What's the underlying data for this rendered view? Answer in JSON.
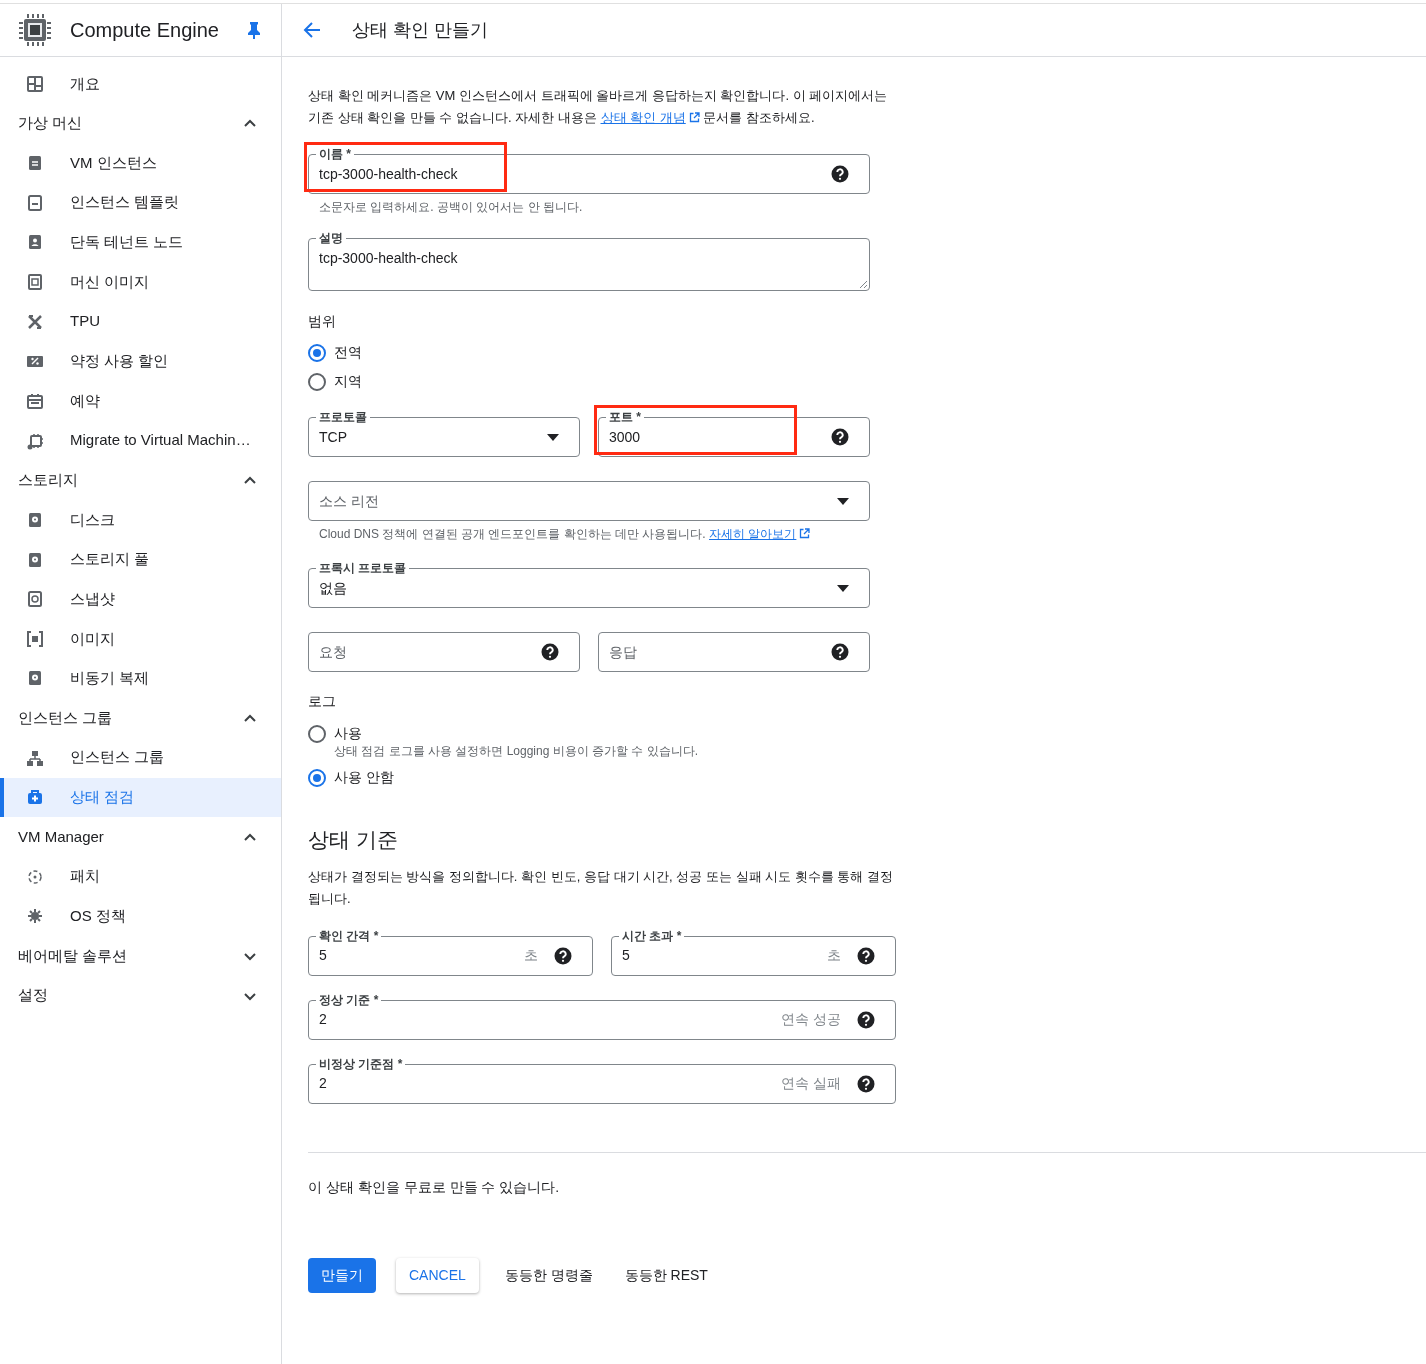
{
  "app": {
    "title": "Compute Engine"
  },
  "sidebar": {
    "items": [
      {
        "kind": "link",
        "label": "개요",
        "selected": false
      },
      {
        "kind": "section",
        "label": "가상 머신",
        "expanded": true,
        "children": [
          {
            "kind": "link",
            "label": "VM 인스턴스",
            "selected": false
          },
          {
            "kind": "link",
            "label": "인스턴스 템플릿",
            "selected": false
          },
          {
            "kind": "link",
            "label": "단독 테넌트 노드",
            "selected": false
          },
          {
            "kind": "link",
            "label": "머신 이미지",
            "selected": false
          },
          {
            "kind": "link",
            "label": "TPU",
            "selected": false
          },
          {
            "kind": "link",
            "label": "약정 사용 할인",
            "selected": false
          },
          {
            "kind": "link",
            "label": "예약",
            "selected": false
          },
          {
            "kind": "link",
            "label": "Migrate to Virtual Machin…",
            "selected": false
          }
        ]
      },
      {
        "kind": "section",
        "label": "스토리지",
        "expanded": true,
        "children": [
          {
            "kind": "link",
            "label": "디스크",
            "selected": false
          },
          {
            "kind": "link",
            "label": "스토리지 풀",
            "selected": false
          },
          {
            "kind": "link",
            "label": "스냅샷",
            "selected": false
          },
          {
            "kind": "link",
            "label": "이미지",
            "selected": false
          },
          {
            "kind": "link",
            "label": "비동기 복제",
            "selected": false
          }
        ]
      },
      {
        "kind": "section",
        "label": "인스턴스 그룹",
        "expanded": true,
        "children": [
          {
            "kind": "link",
            "label": "인스턴스 그룹",
            "selected": false
          },
          {
            "kind": "link",
            "label": "상태 점검",
            "selected": true
          }
        ]
      },
      {
        "kind": "section",
        "label": "VM Manager",
        "expanded": true,
        "children": [
          {
            "kind": "link",
            "label": "패치",
            "selected": false
          },
          {
            "kind": "link",
            "label": "OS 정책",
            "selected": false
          }
        ]
      },
      {
        "kind": "section",
        "label": "베어메탈 솔루션",
        "expanded": false
      },
      {
        "kind": "section",
        "label": "설정",
        "expanded": false
      }
    ]
  },
  "page": {
    "title": "상태 확인 만들기"
  },
  "intro": {
    "before": "상태 확인 메커니즘은 VM 인스턴스에서 트래픽에 올바르게 응답하는지 확인합니다. 이 페이지에서는 기존 상태 확인을 만들 수 없습니다. 자세한 내용은 ",
    "link": "상태 확인 개념",
    "after": " 문서를 참조하세요."
  },
  "name_field": {
    "label": "이름 *",
    "value": "tcp-3000-health-check",
    "help": "소문자로 입력하세요. 공백이 있어서는 안 됩니다.",
    "highlighted": true
  },
  "description_field": {
    "label": "설명",
    "value": "tcp-3000-health-check"
  },
  "scope": {
    "label": "범위",
    "options": [
      {
        "label": "전역",
        "selected": true
      },
      {
        "label": "지역",
        "selected": false
      }
    ]
  },
  "protocol_field": {
    "label": "프로토콜",
    "value": "TCP"
  },
  "port_field": {
    "label": "포트 *",
    "value": "3000",
    "highlighted": true
  },
  "source_region_field": {
    "placeholder": "소스 리전",
    "help": "Cloud DNS 정책에 연결된 공개 엔드포인트를 확인하는 데만 사용됩니다. ",
    "help_link": "자세히 알아보기"
  },
  "proxy_protocol_field": {
    "label": "프록시 프로토콜",
    "value": "없음"
  },
  "request_field": {
    "placeholder": "요청"
  },
  "response_field": {
    "placeholder": "응답"
  },
  "logs": {
    "label": "로그",
    "options": [
      {
        "label": "사용",
        "description": "상태 점검 로그를 사용 설정하면 Logging 비용이 증가할 수 있습니다.",
        "selected": false
      },
      {
        "label": "사용 안함",
        "selected": true
      }
    ]
  },
  "health_criteria": {
    "heading": "상태 기준",
    "description": "상태가 결정되는 방식을 정의합니다. 확인 빈도, 응답 대기 시간, 성공 또는 실패 시도 횟수를 통해 결정됩니다.",
    "fields": [
      {
        "label": "확인 간격 *",
        "value": "5",
        "unit": "초"
      },
      {
        "label": "시간 초과 *",
        "value": "5",
        "unit": "초"
      },
      {
        "label": "정상 기준 *",
        "value": "2",
        "unit": "연속 성공"
      },
      {
        "label": "비정상 기준점 *",
        "value": "2",
        "unit": "연속 실패"
      }
    ]
  },
  "footer_note": "이 상태 확인을 무료로 만들 수 있습니다.",
  "buttons": [
    {
      "label": "만들기",
      "kind": "primary"
    },
    {
      "label": "CANCEL",
      "kind": "outlined"
    },
    {
      "label": "동등한 명령줄",
      "kind": "text"
    },
    {
      "label": "동등한 REST",
      "kind": "text"
    }
  ]
}
